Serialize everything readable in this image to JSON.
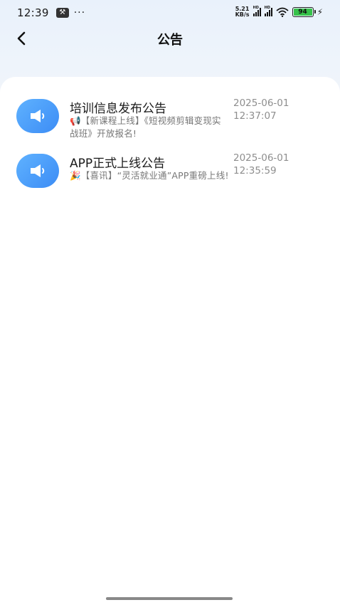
{
  "status_bar": {
    "time": "12:39",
    "more": "···",
    "net_speed_value": "5.21",
    "net_speed_unit": "KB/s",
    "signal_label": "HD",
    "battery": "94"
  },
  "nav": {
    "title": "公告"
  },
  "notices": [
    {
      "title": "培训信息发布公告",
      "emoji": "📢",
      "desc": "【新课程上线】《短视频剪辑变现实战班》开放报名!",
      "date": "2025-06-01",
      "time": "12:37:07"
    },
    {
      "title": "APP正式上线公告",
      "emoji": "🎉",
      "desc": "【喜讯】“灵活就业通”APP重磅上线!",
      "date": "2025-06-01",
      "time": "12:35:59"
    }
  ]
}
